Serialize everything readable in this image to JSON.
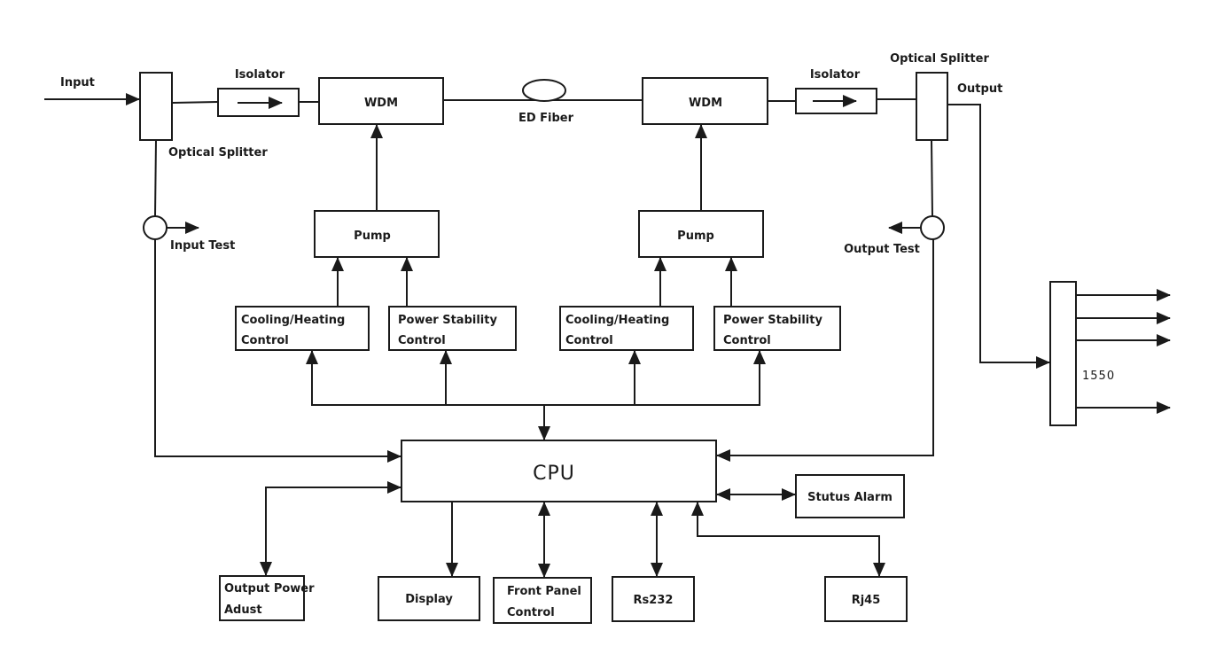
{
  "labels": {
    "input": "Input",
    "optical_splitter_in": "Optical Splitter",
    "isolator_1": "Isolator",
    "wdm_1": "WDM",
    "ed_fiber": "ED Fiber",
    "wdm_2": "WDM",
    "isolator_2": "Isolator",
    "optical_splitter_out": "Optical Splitter",
    "output": "Output",
    "input_test": "Input Test",
    "output_test": "Output Test",
    "pump_1": "Pump",
    "pump_2": "Pump",
    "cooling_1": [
      "Cooling/Heating",
      "Control"
    ],
    "power_1": [
      "Power Stability",
      "Control"
    ],
    "cooling_2": [
      "Cooling/Heating",
      "Control"
    ],
    "power_2": [
      "Power Stability",
      "Control"
    ],
    "splitter_1550": "1550",
    "cpu": "CPU",
    "status_alarm": "Stutus Alarm",
    "output_power": [
      "Output Power",
      "Adust"
    ],
    "display": "Display",
    "front_panel": [
      "Front Panel",
      "Control"
    ],
    "rs232": "Rs232",
    "rj45": "Rj45"
  }
}
